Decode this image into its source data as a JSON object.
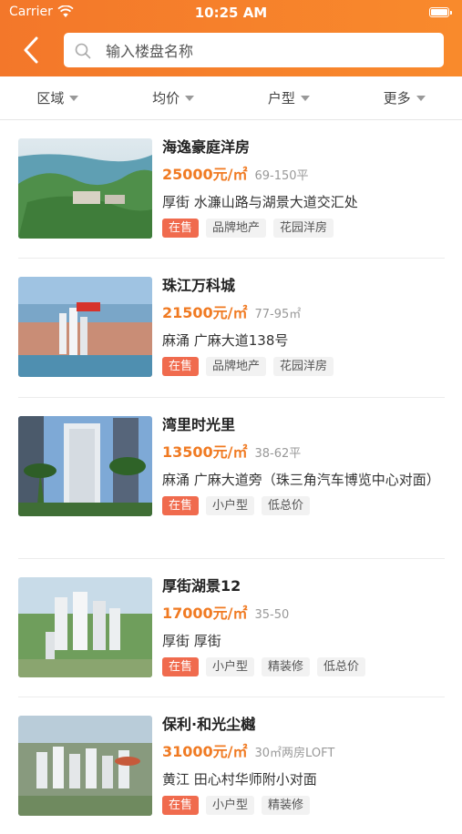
{
  "status_bar": {
    "carrier": "Carrier",
    "time": "10:25 AM"
  },
  "header": {
    "search_placeholder": "输入楼盘名称"
  },
  "filters": [
    "区域",
    "均价",
    "户型",
    "更多"
  ],
  "listings": [
    {
      "name": "海逸豪庭洋房",
      "price": "25000元/㎡",
      "area": "69-150平",
      "address": "厚街 水濂山路与湖景大道交汇处",
      "tags": [
        "在售",
        "品牌地产",
        "花园洋房"
      ]
    },
    {
      "name": "珠江万科城",
      "price": "21500元/㎡",
      "area": "77-95㎡",
      "address": "麻涌 广麻大道138号",
      "tags": [
        "在售",
        "品牌地产",
        "花园洋房"
      ]
    },
    {
      "name": "湾里时光里",
      "price": "13500元/㎡",
      "area": "38-62平",
      "address": "麻涌  广麻大道旁（珠三角汽车博览中心对面）",
      "tags": [
        "在售",
        "小户型",
        "低总价"
      ]
    },
    {
      "name": "厚街湖景12",
      "price": "17000元/㎡",
      "area": "35-50",
      "address": "厚街 厚街",
      "tags": [
        "在售",
        "小户型",
        "精装修",
        "低总价"
      ]
    },
    {
      "name": "保利·和光尘樾",
      "price": "31000元/㎡",
      "area": "30㎡两房LOFT",
      "address": "黄江 田心村华师附小对面",
      "tags": [
        "在售",
        "小户型",
        "精装修"
      ]
    }
  ],
  "colors": {
    "header_orange": "#f3772a",
    "price_orange": "#f07a22",
    "sale_tag": "#f06b4e"
  }
}
